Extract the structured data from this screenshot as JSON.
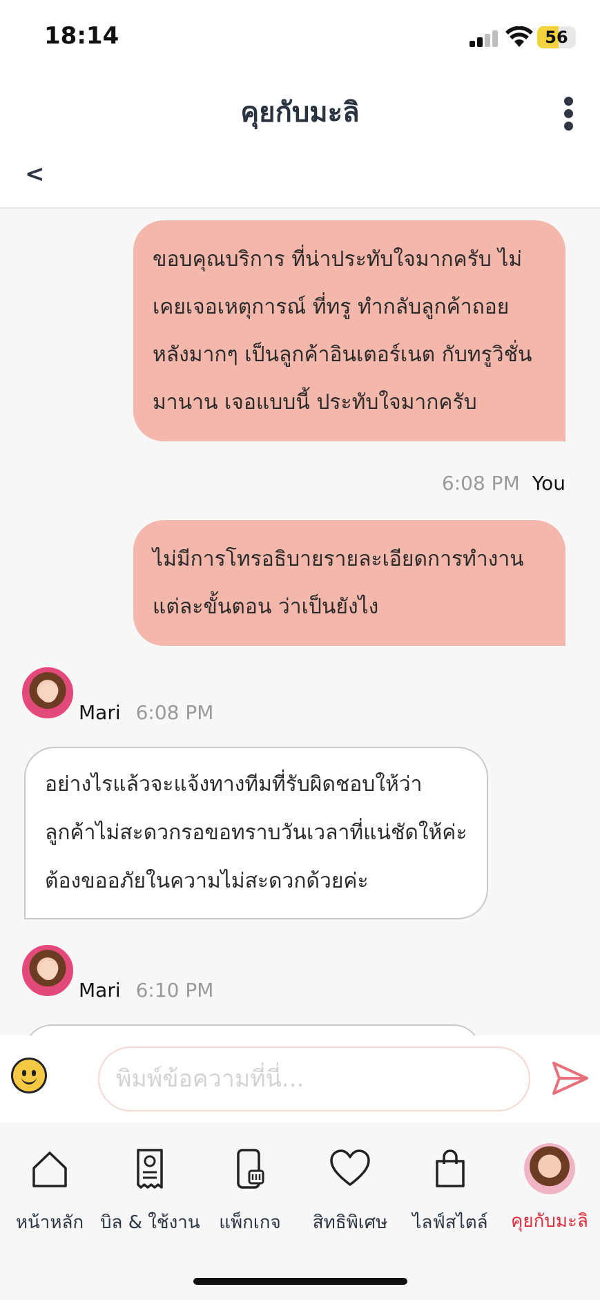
{
  "status_bar": {
    "time": "18:14",
    "battery": "56",
    "battery_level": 0.56
  },
  "header": {
    "title": "คุยกับมะลิ",
    "back_label": "<"
  },
  "messages": [
    {
      "sender": "user",
      "text": "ขอบคุณบริการ ที่น่าประทับใจมากครับ ไม่\nเคยเจอเหตุการณ์ ที่ทรู ทำกลับลูกค้าถอย\nหลังมากๆ เป็นลูกค้าอินเตอร์เนต กับทรูวิชั่น\nมานาน เจอแบบนี้ ประทับใจมากครับ"
    },
    {
      "sender": "user",
      "time": "6:08 PM",
      "name": "You",
      "text": "ไม่มีการโทรอธิบายรายละเอียดการทำงาน\nแต่ละขั้นตอน ว่าเป็นยังไง"
    },
    {
      "sender": "bot",
      "name": "Mari",
      "time": "6:08 PM",
      "text": "อย่างไรแล้วจะแจ้งทางทีมที่รับผิดชอบให้ว่า\nลูกค้าไม่สะดวกรอขอทราบวันเวลาที่แน่ชัดให้ค่ะ\nต้องขออภัยในความไม่สะดวกด้วยค่ะ"
    },
    {
      "sender": "bot",
      "name": "Mari",
      "time": "6:10 PM",
      "text": ""
    }
  ],
  "input": {
    "placeholder": "พิมพ์ข้อความที่นี่..."
  },
  "nav": [
    {
      "label": "หน้าหลัก",
      "icon": "home-icon"
    },
    {
      "label": "บิล & ใช้งาน",
      "icon": "bill-icon"
    },
    {
      "label": "แพ็กเกจ",
      "icon": "package-icon"
    },
    {
      "label": "สิทธิพิเศษ",
      "icon": "heart-icon"
    },
    {
      "label": "ไลฟ์สไตล์",
      "icon": "shopping-bag-icon"
    },
    {
      "label": "คุยกับมะลิ",
      "icon": "mali-avatar-icon",
      "active": true
    }
  ],
  "colors": {
    "user_bubble": "#f4b7ab",
    "active_nav": "#e02d3c",
    "send": "#e8707a"
  }
}
